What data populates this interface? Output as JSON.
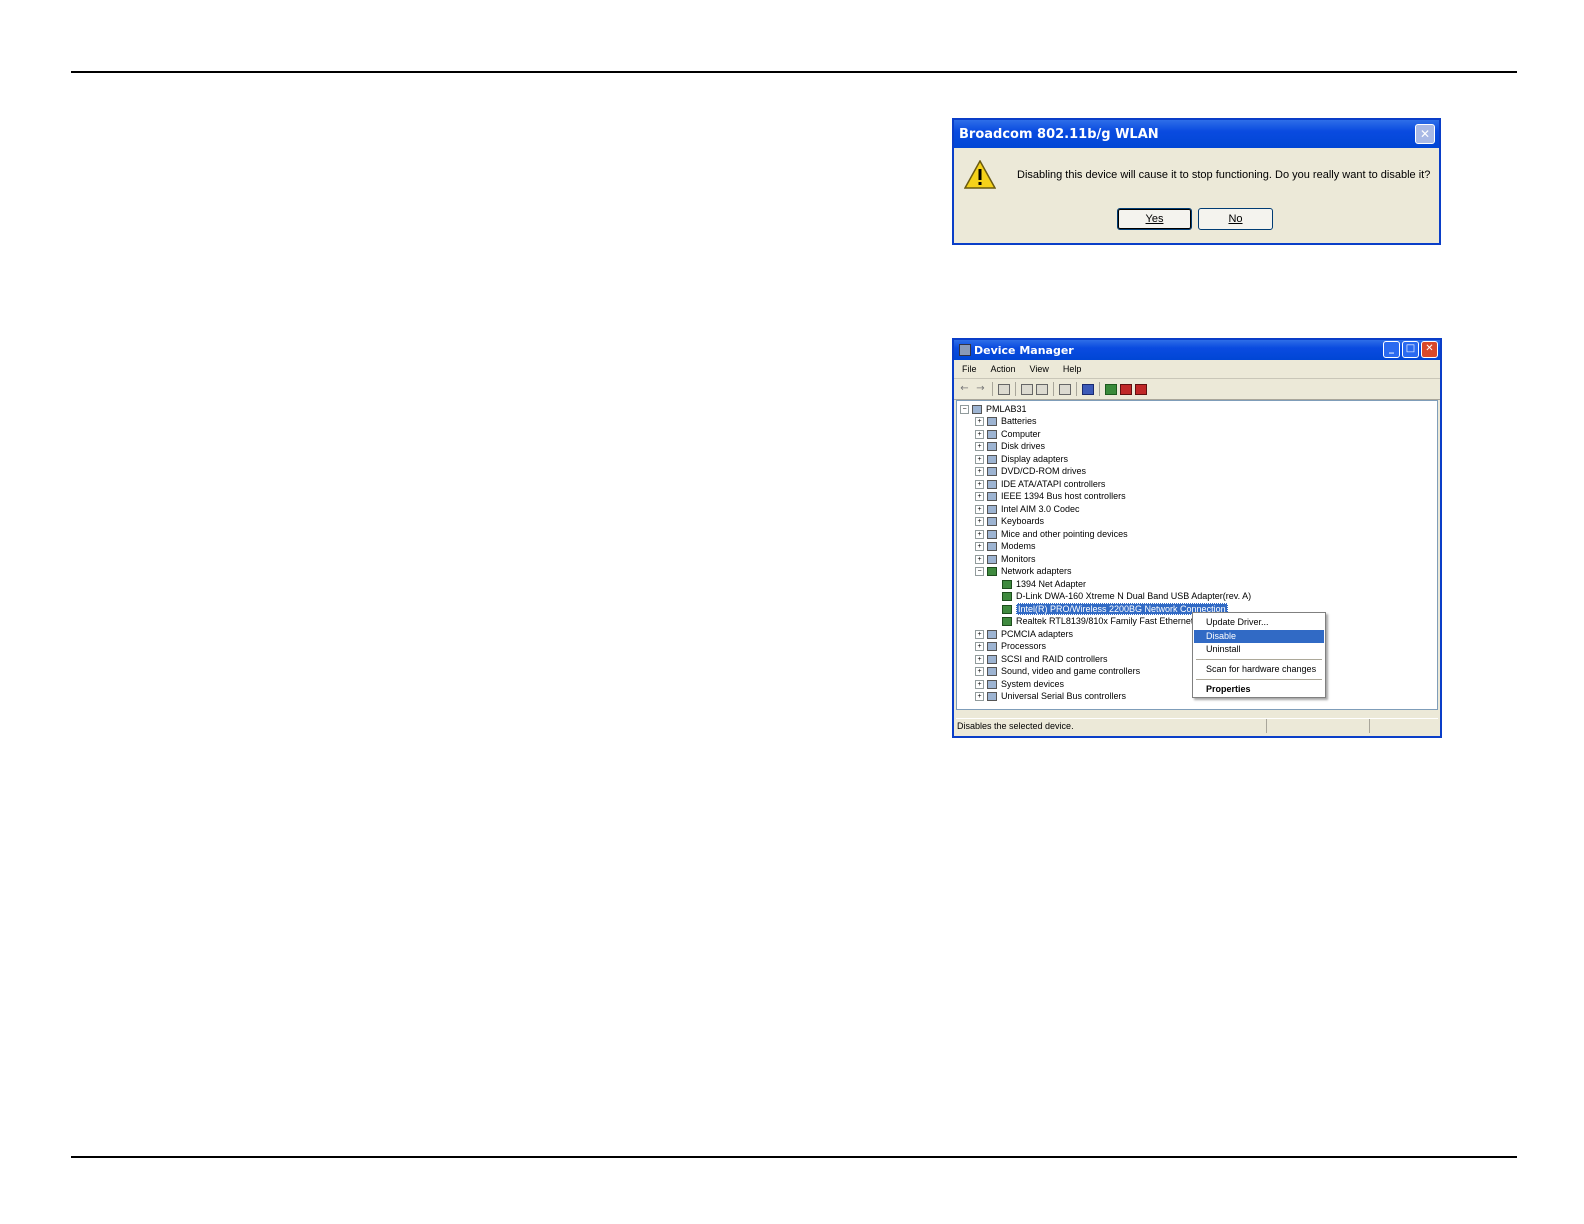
{
  "message_box": {
    "title": "Broadcom 802.11b/g WLAN",
    "close_glyph": "✕",
    "message": "Disabling this device will cause it to stop functioning. Do you really want to disable it?",
    "yes_label": "Yes",
    "no_label": "No",
    "icon": "warning-icon"
  },
  "device_manager": {
    "title": "Device Manager",
    "menu": [
      "File",
      "Action",
      "View",
      "Help"
    ],
    "root": "PMLAB31",
    "categories": [
      "Batteries",
      "Computer",
      "Disk drives",
      "Display adapters",
      "DVD/CD-ROM drives",
      "IDE ATA/ATAPI controllers",
      "IEEE 1394 Bus host controllers",
      "Intel AIM 3.0 Codec",
      "Keyboards",
      "Mice and other pointing devices",
      "Modems",
      "Monitors",
      "Network adapters"
    ],
    "network_children": [
      "1394 Net Adapter",
      "D-Link DWA-160 Xtreme N Dual Band USB Adapter(rev. A)",
      "Intel(R) PRO/Wireless 2200BG Network Connection",
      "Realtek RTL8139/810x Family Fast Ethernet NIC"
    ],
    "categories_after": [
      "PCMCIA adapters",
      "Processors",
      "SCSI and RAID controllers",
      "Sound, video and game controllers",
      "System devices",
      "Universal Serial Bus controllers"
    ],
    "context_menu": {
      "update_driver": "Update Driver...",
      "disable": "Disable",
      "uninstall": "Uninstall",
      "scan": "Scan for hardware changes",
      "properties": "Properties"
    },
    "status_text": "Disables the selected device.",
    "expand_glyph": "+",
    "collapse_glyph": "−",
    "toolbar_icons": [
      "back-icon",
      "forward-icon",
      "computer-icon",
      "properties-icon",
      "print-icon",
      "help-icon",
      "scan-icon",
      "update-driver-icon",
      "uninstall-icon",
      "disable-icon"
    ]
  }
}
